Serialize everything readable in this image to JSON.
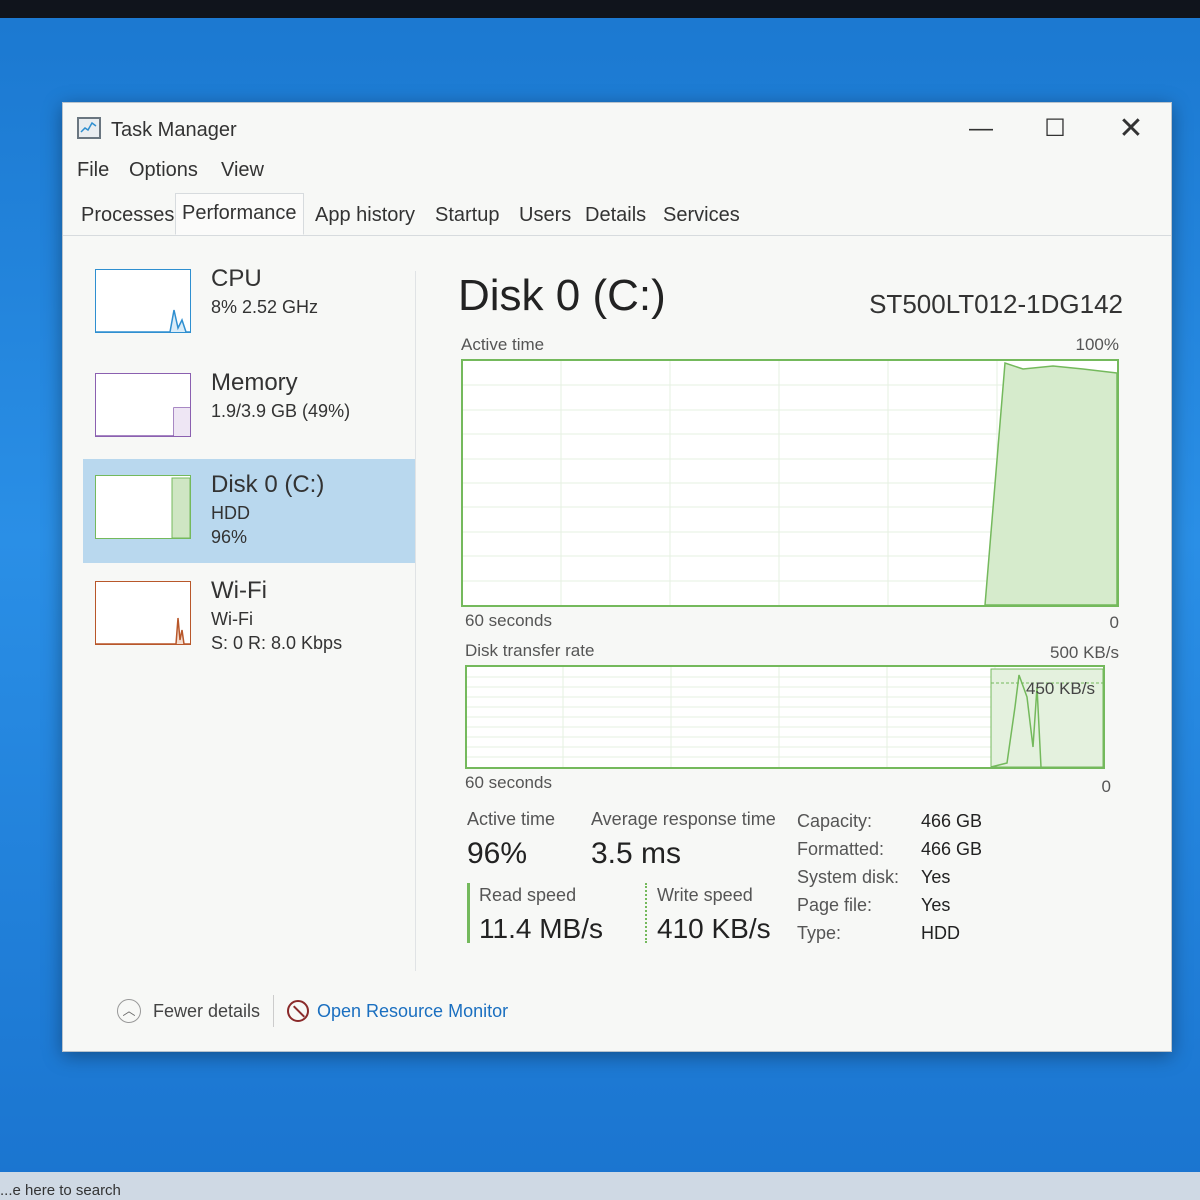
{
  "window": {
    "title": "Task Manager",
    "minimize": "—",
    "maximize": "☐",
    "close": "✕"
  },
  "menu": [
    "File",
    "Options",
    "View"
  ],
  "tabs": [
    "Processes",
    "Performance",
    "App history",
    "Startup",
    "Users",
    "Details",
    "Services"
  ],
  "active_tab": "Performance",
  "sidebar": {
    "cpu": {
      "name": "CPU",
      "line1": "8%  2.52 GHz"
    },
    "memory": {
      "name": "Memory",
      "line1": "1.9/3.9 GB (49%)"
    },
    "disk": {
      "name": "Disk 0 (C:)",
      "line1": "HDD",
      "line2": "96%"
    },
    "wifi": {
      "name": "Wi-Fi",
      "line1": "Wi-Fi",
      "line2": "S: 0  R: 8.0 Kbps"
    }
  },
  "main": {
    "title": "Disk 0 (C:)",
    "model": "ST500LT012-1DG142",
    "graph1": {
      "label": "Active time",
      "max": "100%",
      "time": "60 seconds",
      "min": "0"
    },
    "graph2": {
      "label": "Disk transfer rate",
      "max": "500 KB/s",
      "marker": "450 KB/s",
      "time": "60 seconds",
      "min": "0"
    },
    "stats": {
      "active_time_label": "Active time",
      "active_time_value": "96%",
      "avg_response_label": "Average response time",
      "avg_response_value": "3.5 ms",
      "read_label": "Read speed",
      "read_value": "11.4 MB/s",
      "write_label": "Write speed",
      "write_value": "410 KB/s"
    },
    "properties": [
      {
        "key": "Capacity:",
        "value": "466 GB"
      },
      {
        "key": "Formatted:",
        "value": "466 GB"
      },
      {
        "key": "System disk:",
        "value": "Yes"
      },
      {
        "key": "Page file:",
        "value": "Yes"
      },
      {
        "key": "Type:",
        "value": "HDD"
      }
    ]
  },
  "footer": {
    "fewer_details": "Fewer details",
    "open_resource_monitor": "Open Resource Monitor"
  },
  "taskbar": {
    "search": "...e here to search"
  },
  "colors": {
    "disk_green": "#74b95c",
    "cpu_blue": "#2f8fd0",
    "memory_purple": "#8b60b0",
    "wifi_red": "#b8572a",
    "selected_bg": "#b9d8ee",
    "link_blue": "#1a6fc0"
  }
}
